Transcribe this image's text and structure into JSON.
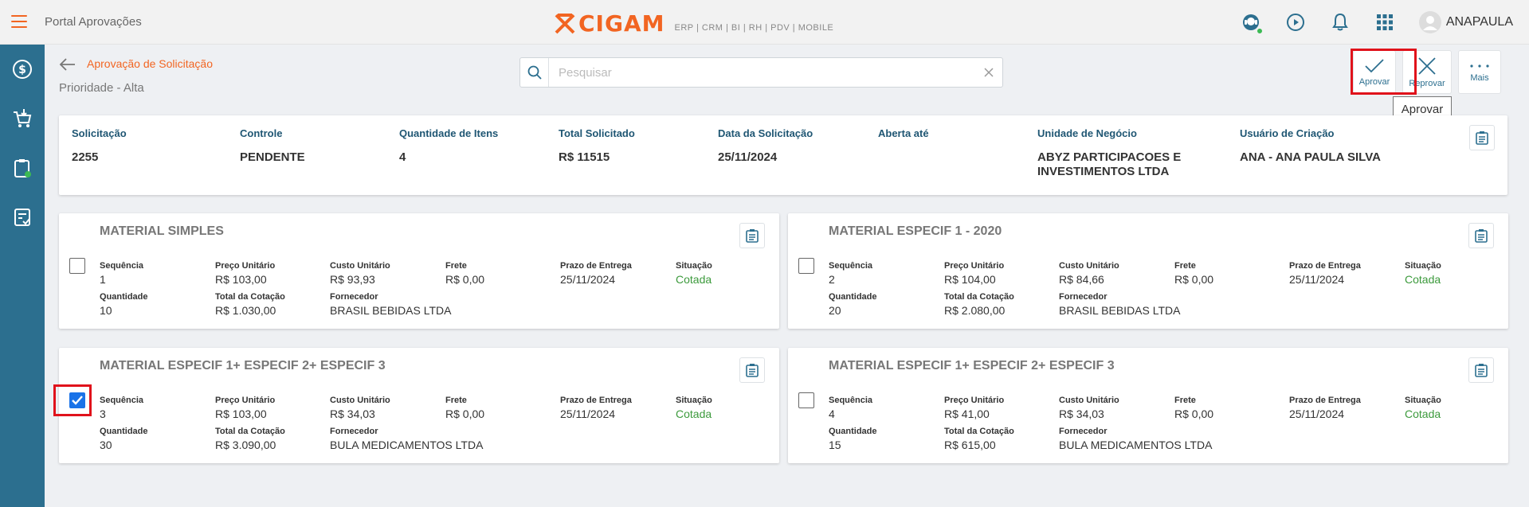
{
  "app": {
    "title": "Portal Aprovações",
    "logo_text": "CIGAM",
    "logo_sub": "ERP | CRM | BI | RH | PDV | MOBILE",
    "user": "ANAPAULA"
  },
  "header": {
    "breadcrumb": "Aprovação de Solicitação",
    "priority": "Prioridade - Alta",
    "search_placeholder": "Pesquisar",
    "search_value": ""
  },
  "actions": {
    "approve": "Aprovar",
    "reject": "Reprovar",
    "more": "Mais",
    "tooltip": "Aprovar"
  },
  "summary": {
    "solicitacao_label": "Solicitação",
    "solicitacao": "2255",
    "controle_label": "Controle",
    "controle": "PENDENTE",
    "qtd_itens_label": "Quantidade de Itens",
    "qtd_itens": "4",
    "total_label": "Total Solicitado",
    "total": "R$ 11515",
    "data_label": "Data da Solicitação",
    "data": "25/11/2024",
    "aberta_label": "Aberta até",
    "aberta": "",
    "unidade_label": "Unidade de Negócio",
    "unidade": "ABYZ PARTICIPACOES E INVESTIMENTOS LTDA",
    "usuario_label": "Usuário de Criação",
    "usuario": "ANA - ANA PAULA SILVA"
  },
  "labels": {
    "sequencia": "Sequência",
    "preco": "Preço Unitário",
    "custo": "Custo Unitário",
    "frete": "Frete",
    "prazo": "Prazo de Entrega",
    "situacao": "Situação",
    "quantidade": "Quantidade",
    "total_cotacao": "Total da Cotação",
    "fornecedor": "Fornecedor"
  },
  "items": [
    {
      "title": "MATERIAL SIMPLES",
      "sequencia": "1",
      "preco": "R$ 103,00",
      "custo": "R$ 93,93",
      "frete": "R$ 0,00",
      "prazo": "25/11/2024",
      "situacao": "Cotada",
      "quantidade": "10",
      "total_cotacao": "R$ 1.030,00",
      "fornecedor": "BRASIL BEBIDAS LTDA",
      "checked": false
    },
    {
      "title": "MATERIAL ESPECIF 1 - 2020",
      "sequencia": "2",
      "preco": "R$ 104,00",
      "custo": "R$ 84,66",
      "frete": "R$ 0,00",
      "prazo": "25/11/2024",
      "situacao": "Cotada",
      "quantidade": "20",
      "total_cotacao": "R$ 2.080,00",
      "fornecedor": "BRASIL BEBIDAS LTDA",
      "checked": false
    },
    {
      "title": "MATERIAL ESPECIF 1+ ESPECIF 2+ ESPECIF 3",
      "sequencia": "3",
      "preco": "R$ 103,00",
      "custo": "R$ 34,03",
      "frete": "R$ 0,00",
      "prazo": "25/11/2024",
      "situacao": "Cotada",
      "quantidade": "30",
      "total_cotacao": "R$ 3.090,00",
      "fornecedor": "BULA MEDICAMENTOS LTDA",
      "checked": true
    },
    {
      "title": "MATERIAL ESPECIF 1+ ESPECIF 2+ ESPECIF 3",
      "sequencia": "4",
      "preco": "R$ 41,00",
      "custo": "R$ 34,03",
      "frete": "R$ 0,00",
      "prazo": "25/11/2024",
      "situacao": "Cotada",
      "quantidade": "15",
      "total_cotacao": "R$ 615,00",
      "fornecedor": "BULA MEDICAMENTOS LTDA",
      "checked": false
    }
  ],
  "colors": {
    "accent": "#f26522",
    "sidebar": "#2c6f8f",
    "label_blue": "#1f5673",
    "status_green": "#3c9a3c",
    "highlight_red": "#e0121b"
  }
}
